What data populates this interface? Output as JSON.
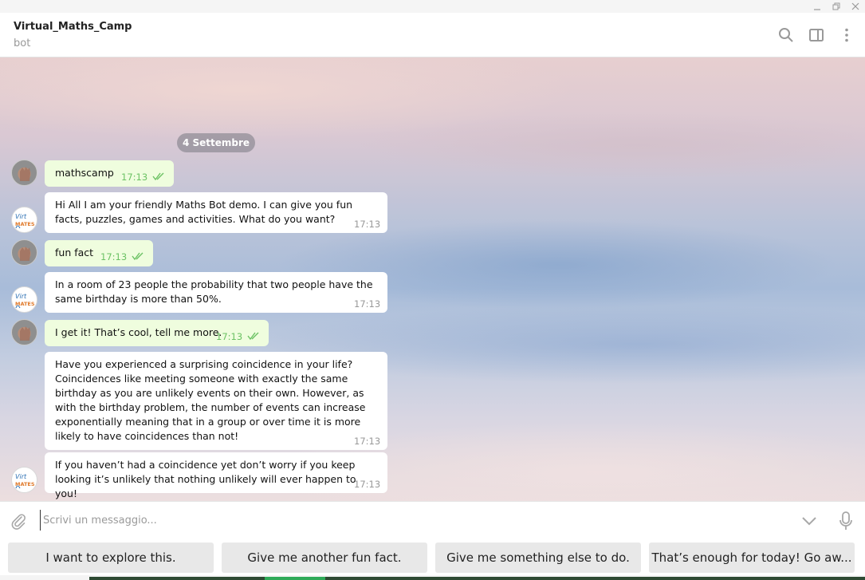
{
  "window": {
    "controls": [
      "minimize-icon",
      "restore-icon",
      "close-icon"
    ]
  },
  "header": {
    "title": "Virtual_Maths_Camp",
    "subtitle": "bot",
    "icons": [
      "search-icon",
      "sidebar-toggle-icon",
      "more-options-icon"
    ]
  },
  "chat": {
    "date_label": "4 Settembre",
    "messages": [
      {
        "direction": "out",
        "text": "mathscamp",
        "time": "17:13",
        "read": true
      },
      {
        "direction": "in",
        "text": "Hi All I am your friendly Maths Bot demo. I can give you fun facts, puzzles, games and activities. What do you want?",
        "time": "17:13"
      },
      {
        "direction": "out",
        "text": "fun fact",
        "time": "17:13",
        "read": true
      },
      {
        "direction": "in",
        "text": "In a room of 23 people the probability that two people have the same birthday is more than 50%.",
        "time": "17:13"
      },
      {
        "direction": "out",
        "text": "I get it! That’s cool, tell me more.",
        "time": "17:13",
        "read": true
      },
      {
        "direction": "in",
        "text": "Have you experienced a surprising coincidence in your life? Coincidences like meeting someone with exactly the same birthday as you are unlikely events on their own. However, as with the birthday problem, the number of events can increase exponentially meaning that in a group or over time it is more likely to have coincidences than not!",
        "time": "17:13"
      },
      {
        "direction": "in",
        "text": "If you haven’t had a coincidence yet don’t worry if you keep looking it’s unlikely that nothing unlikely will ever happen to you!",
        "time": "17:13"
      }
    ],
    "bot_avatar_text": "Virt MATES"
  },
  "composer": {
    "placeholder": "Scrivi un messaggio...",
    "icons": [
      "attach-icon",
      "keyboard-toggle-icon",
      "microphone-icon"
    ]
  },
  "keyboard": {
    "buttons": [
      "I want to explore this.",
      "Give me another fun fact.",
      "Give me something else to do.",
      "That’s enough for today! Go aw..."
    ]
  },
  "colors": {
    "outgoing_bubble": "#effdde",
    "incoming_bubble": "#ffffff",
    "outgoing_time": "#6cc264",
    "date_pill": "#8a8a96"
  }
}
